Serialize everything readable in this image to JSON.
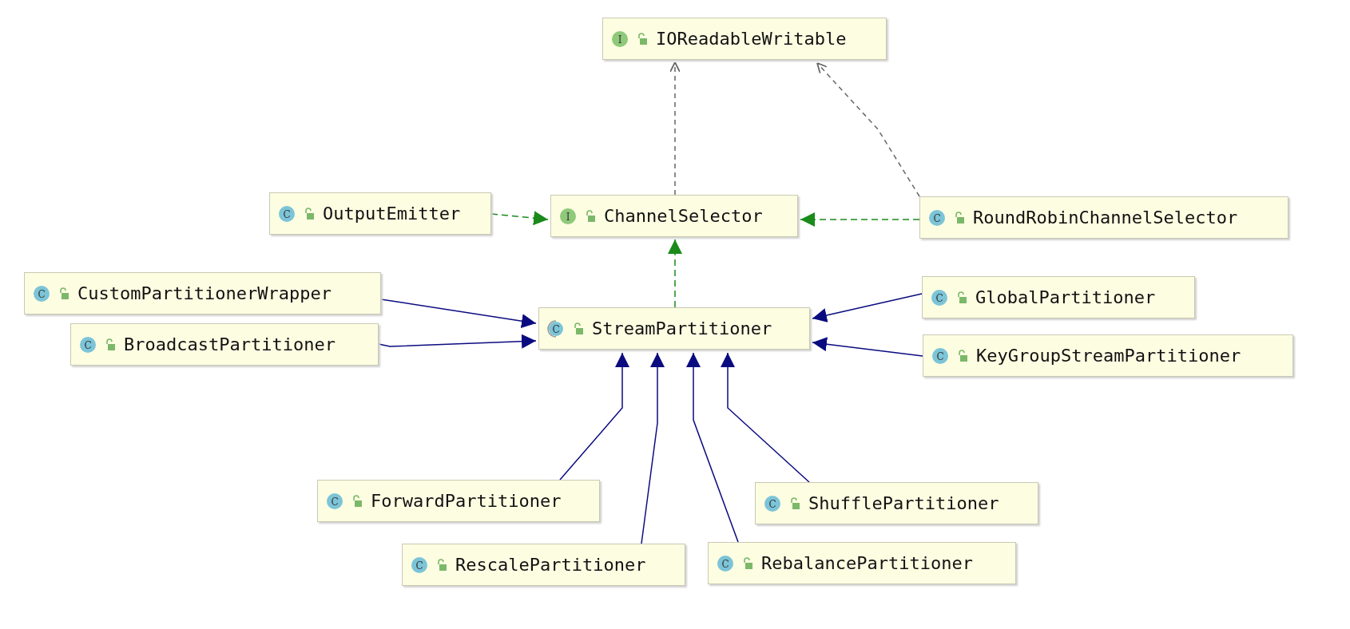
{
  "diagram": {
    "nodes": [
      {
        "name": "IOReadableWritable",
        "kind": "interface",
        "icon_letter": "I"
      },
      {
        "name": "OutputEmitter",
        "kind": "class",
        "icon_letter": "C"
      },
      {
        "name": "ChannelSelector",
        "kind": "interface",
        "icon_letter": "I"
      },
      {
        "name": "RoundRobinChannelSelector",
        "kind": "class",
        "icon_letter": "C"
      },
      {
        "name": "CustomPartitionerWrapper",
        "kind": "class",
        "icon_letter": "C"
      },
      {
        "name": "StreamPartitioner",
        "kind": "abstract",
        "icon_letter": "C"
      },
      {
        "name": "GlobalPartitioner",
        "kind": "class",
        "icon_letter": "C"
      },
      {
        "name": "BroadcastPartitioner",
        "kind": "class",
        "icon_letter": "C"
      },
      {
        "name": "KeyGroupStreamPartitioner",
        "kind": "class",
        "icon_letter": "C"
      },
      {
        "name": "ForwardPartitioner",
        "kind": "class",
        "icon_letter": "C"
      },
      {
        "name": "ShufflePartitioner",
        "kind": "class",
        "icon_letter": "C"
      },
      {
        "name": "RescalePartitioner",
        "kind": "class",
        "icon_letter": "C"
      },
      {
        "name": "RebalancePartitioner",
        "kind": "class",
        "icon_letter": "C"
      }
    ]
  }
}
